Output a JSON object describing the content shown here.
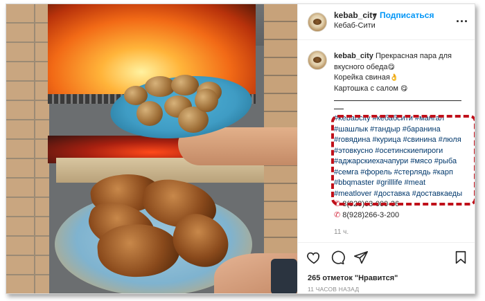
{
  "post": {
    "username": "kebab_city",
    "separator_dot": "•",
    "follow_label": "Подписаться",
    "location": "Кебаб-Сити",
    "more_label": "...",
    "accent_color": "#0095f6",
    "highlight_color": "#c0101a"
  },
  "caption": {
    "username": "kebab_city",
    "lines": [
      "Прекрасная пара для",
      "вкусного обеда",
      "Корейка свиная",
      "Картошка с салом"
    ],
    "emojis": [
      "😋",
      "👌",
      "😋"
    ],
    "hashtag_lines": [
      "#kebabcity #кебабсити #мангал",
      "#шашлык #тандыр #баранина",
      "#говядина #курица #свинина #люля",
      "#этовкусно #осетинскиепироги",
      "#аджарскиехачапури #мясо #рыба",
      "#семга #форель #стерлядь #карп",
      "#bbqmaster #grilllife #meat",
      "#meatlover #доставка #доставкаеды"
    ],
    "phones": [
      "8(928)63-000-36",
      "8(928)266-3-200"
    ],
    "age": "11 ч."
  },
  "actions": {
    "icons": [
      "heart-icon",
      "comment-icon",
      "share-icon",
      "bookmark-icon"
    ],
    "likes": "265 отметок \"Нравится\"",
    "posted": "11 ЧАСОВ НАЗАД"
  }
}
